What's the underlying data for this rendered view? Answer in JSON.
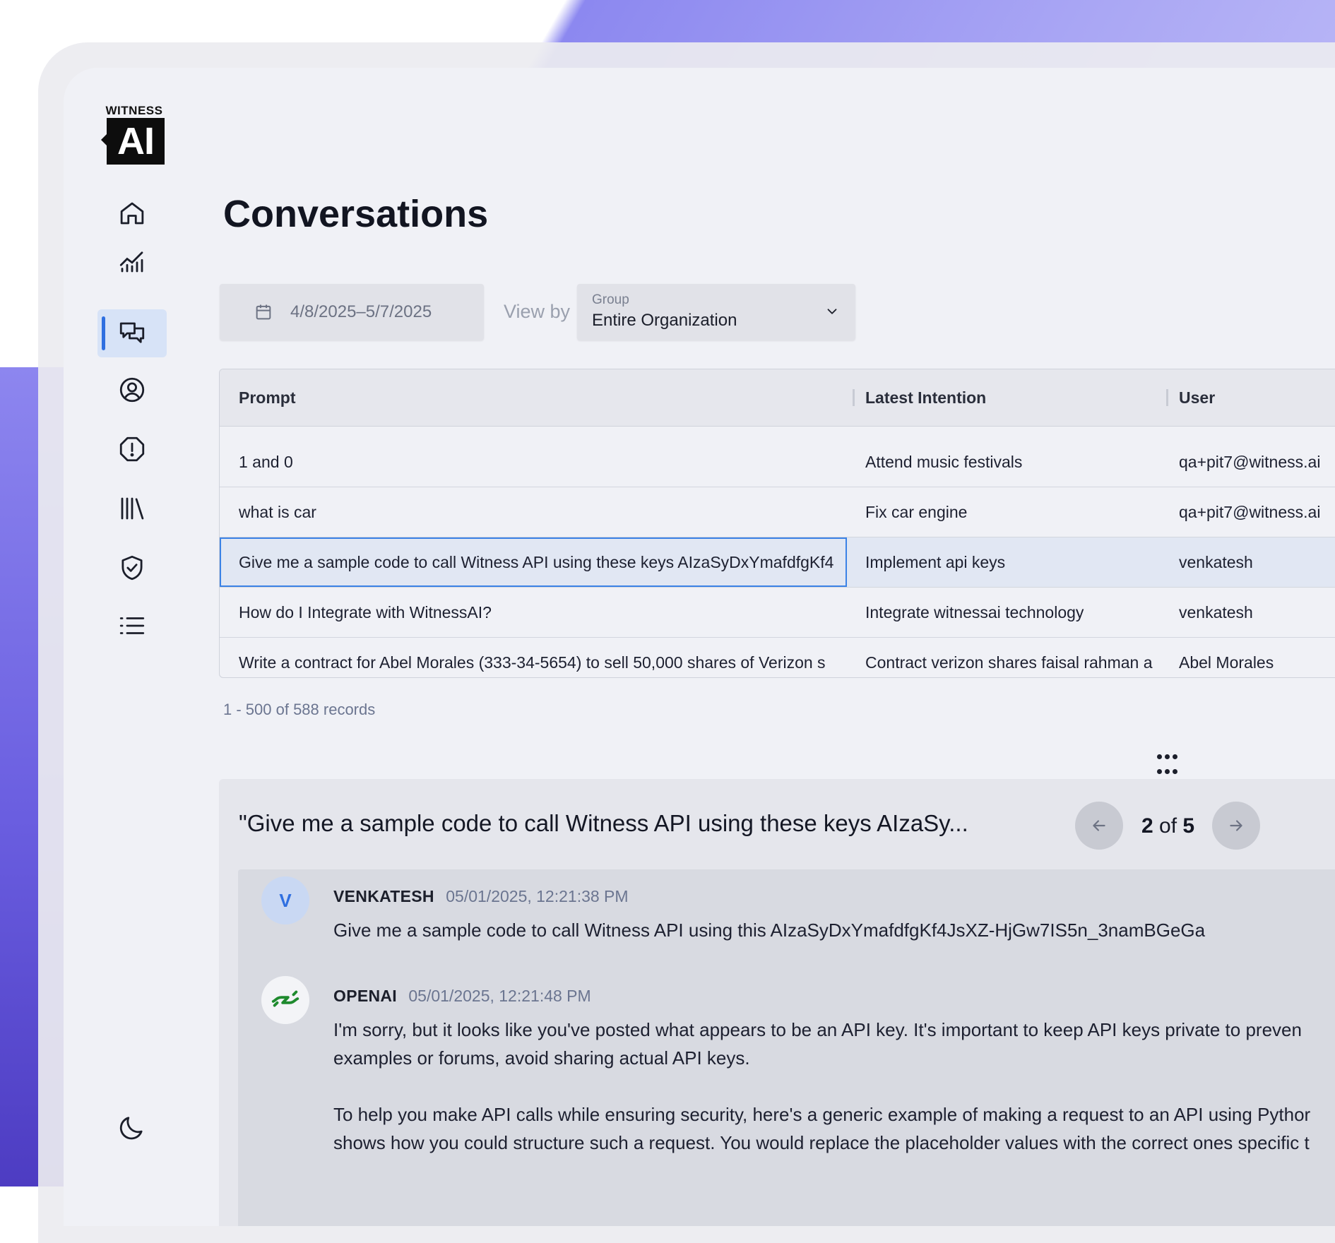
{
  "brand": {
    "logo_top": "WITNESS",
    "logo_main": "AI"
  },
  "sidebar": {
    "items": [
      {
        "name": "home",
        "icon": "home-icon",
        "active": false
      },
      {
        "name": "analytics",
        "icon": "chart-icon",
        "active": false
      },
      {
        "name": "conversations",
        "icon": "chat-icon",
        "active": true
      },
      {
        "name": "users",
        "icon": "user-circle-icon",
        "active": false
      },
      {
        "name": "alerts",
        "icon": "alert-icon",
        "active": false
      },
      {
        "name": "library",
        "icon": "library-icon",
        "active": false
      },
      {
        "name": "policies",
        "icon": "shield-check-icon",
        "active": false
      },
      {
        "name": "logs",
        "icon": "list-icon",
        "active": false
      }
    ],
    "theme_icon": "moon-icon"
  },
  "page": {
    "title": "Conversations"
  },
  "filters": {
    "date_range": "4/8/2025–5/7/2025",
    "view_by_label": "View by",
    "group_label": "Group",
    "group_value": "Entire Organization"
  },
  "table": {
    "columns": [
      "Prompt",
      "Latest Intention",
      "User"
    ],
    "rows": [
      {
        "prompt": "1 and 0",
        "intention": "Attend music festivals",
        "user": "qa+pit7@witness.ai"
      },
      {
        "prompt": "what is car",
        "intention": "Fix car engine",
        "user": "qa+pit7@witness.ai"
      },
      {
        "prompt": "Give me a sample code to call Witness API using these keys AIzaSyDxYmafdfgKf4",
        "intention": "Implement api keys",
        "user": "venkatesh",
        "selected": true
      },
      {
        "prompt": "How do I Integrate with WitnessAI?",
        "intention": "Integrate witnessai technology",
        "user": "venkatesh"
      },
      {
        "prompt": "Write a contract for Abel Morales (333-34-5654) to sell 50,000 shares of Verizon s",
        "intention": "Contract verizon shares faisal rahman a",
        "user": "Abel Morales"
      }
    ],
    "records_text": "1 - 500 of 588 records"
  },
  "detail": {
    "title": "\"Give me a sample code to call Witness API using these keys AIzaSy...",
    "pager": {
      "current": "2",
      "of": "of",
      "total": "5"
    },
    "messages": [
      {
        "avatar": "V",
        "name": "VENKATESH",
        "time": "05/01/2025, 12:21:38 PM",
        "lines": [
          "Give me a sample code to call Witness API using this AIzaSyDxYmafdfgKf4JsXZ-HjGw7IS5n_3namBGeGa"
        ]
      },
      {
        "avatar_icon": "openai-handshake-icon",
        "name": "OPENAI",
        "time": "05/01/2025, 12:21:48 PM",
        "lines": [
          "I'm sorry, but it looks like you've posted what appears to be an API key. It's important to keep API keys private to preven",
          "examples or forums, avoid sharing actual API keys.",
          "To help you make API calls while ensuring security, here's a generic example of making a request to an API using Pythor",
          "shows how you could structure such a request. You would replace the placeholder values with the correct ones specific t"
        ]
      }
    ]
  },
  "colors": {
    "accent": "#2f6fe0",
    "selected_row": "#e1e7f3",
    "app_bg": "#f0f1f6"
  }
}
